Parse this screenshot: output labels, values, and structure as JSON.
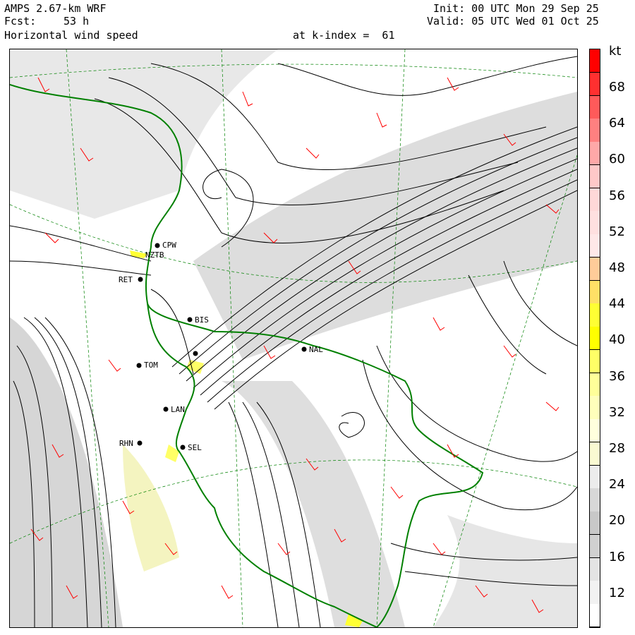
{
  "header": {
    "model": "AMPS 2.67-km WRF",
    "forecast_label": "Fcst:",
    "forecast_hours": "53 h",
    "field": "Horizontal wind speed",
    "level": "at k-index =  61",
    "init": "Init: 00 UTC Mon 29 Sep 25",
    "valid": "Valid: 05 UTC Wed 01 Oct 25"
  },
  "colorbar": {
    "unit": "kt",
    "tick_labels": [
      "68",
      "64",
      "60",
      "56",
      "52",
      "48",
      "44",
      "40",
      "36",
      "32",
      "28",
      "24",
      "20",
      "16",
      "12"
    ],
    "colors_top_to_bottom": [
      "#ff0000",
      "#ff3030",
      "#ff5a5a",
      "#ff8080",
      "#ffa8a8",
      "#ffc8c8",
      "#ffd8d8",
      "#ffe0e0",
      "#ffe8e8",
      "#ffcc99",
      "#ffe066",
      "#ffff33",
      "#ffff00",
      "#ffff66",
      "#ffff99",
      "#ffffbb",
      "#ffffdd",
      "#fafad2",
      "#ececec",
      "#d8d8d8",
      "#c8c8c8",
      "#d0d0d0",
      "#e4e4e4",
      "#f2f2f2",
      "#ffffff"
    ]
  },
  "stations": [
    {
      "id": "CPW",
      "name": "CPW"
    },
    {
      "id": "NZTB",
      "name": "NZTB"
    },
    {
      "id": "RET",
      "name": "RET"
    },
    {
      "id": "BIS",
      "name": "BIS"
    },
    {
      "id": "TOM",
      "name": "TOM"
    },
    {
      "id": "LAN",
      "name": "LAN"
    },
    {
      "id": "RHN",
      "name": "RHN"
    },
    {
      "id": "SEL",
      "name": "SEL"
    },
    {
      "id": "NAL",
      "name": "NAL"
    }
  ],
  "colors": {
    "coastline": "#008000",
    "wind_barbs": "#ff0000",
    "streamlines": "#000000",
    "graticule": "#008000"
  }
}
